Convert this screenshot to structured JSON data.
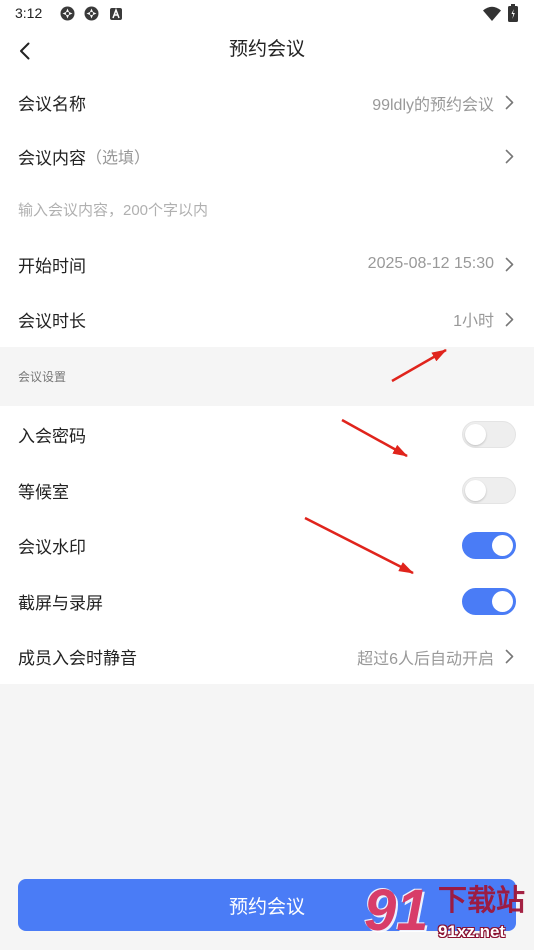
{
  "status_bar": {
    "time": "3:12",
    "left_icons": [
      "app-notification-icon",
      "app-notification-icon",
      "a-letter-icon"
    ],
    "right_icons": [
      "wifi-icon",
      "battery-icon"
    ]
  },
  "header": {
    "title": "预约会议",
    "back_icon": "chevron-left-icon"
  },
  "form": {
    "name": {
      "label": "会议名称",
      "value": "99ldly的预约会议"
    },
    "content": {
      "label": "会议内容",
      "hint": "（选填）",
      "placeholder": "输入会议内容，200个字以内"
    },
    "start_time": {
      "label": "开始时间",
      "value": "2025-08-12 15:30"
    },
    "duration": {
      "label": "会议时长",
      "value": "1小时"
    }
  },
  "settings": {
    "section_title": "会议设置",
    "items": [
      {
        "label": "入会密码",
        "enabled": false
      },
      {
        "label": "等候室",
        "enabled": false
      },
      {
        "label": "会议水印",
        "enabled": true
      },
      {
        "label": "截屏与录屏",
        "enabled": true
      }
    ],
    "mute": {
      "label": "成员入会时静音",
      "value": "超过6人后自动开启"
    }
  },
  "submit_button": "预约会议",
  "watermark": {
    "logo_mark": "91",
    "brand": "下载站",
    "url": "91xz.net"
  },
  "colors": {
    "accent": "#4a7cf6",
    "annotation": "#e0241c",
    "text_primary": "#222222",
    "text_secondary": "#999999"
  }
}
